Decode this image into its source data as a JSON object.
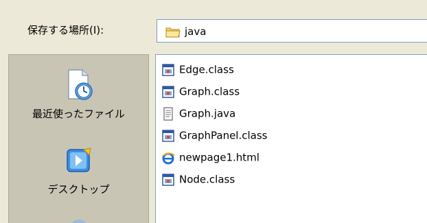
{
  "lookin": {
    "label": "保存する場所(I):",
    "value": "java"
  },
  "places": [
    {
      "label": "最近使ったファイル",
      "icon": "recent-documents-icon"
    },
    {
      "label": "デスクトップ",
      "icon": "desktop-icon"
    }
  ],
  "files": [
    {
      "name": "Edge.class",
      "icon": "class-file-icon"
    },
    {
      "name": "Graph.class",
      "icon": "class-file-icon"
    },
    {
      "name": "Graph.java",
      "icon": "text-file-icon"
    },
    {
      "name": "GraphPanel.class",
      "icon": "class-file-icon"
    },
    {
      "name": "newpage1.html",
      "icon": "ie-html-file-icon"
    },
    {
      "name": "Node.class",
      "icon": "class-file-icon"
    }
  ]
}
